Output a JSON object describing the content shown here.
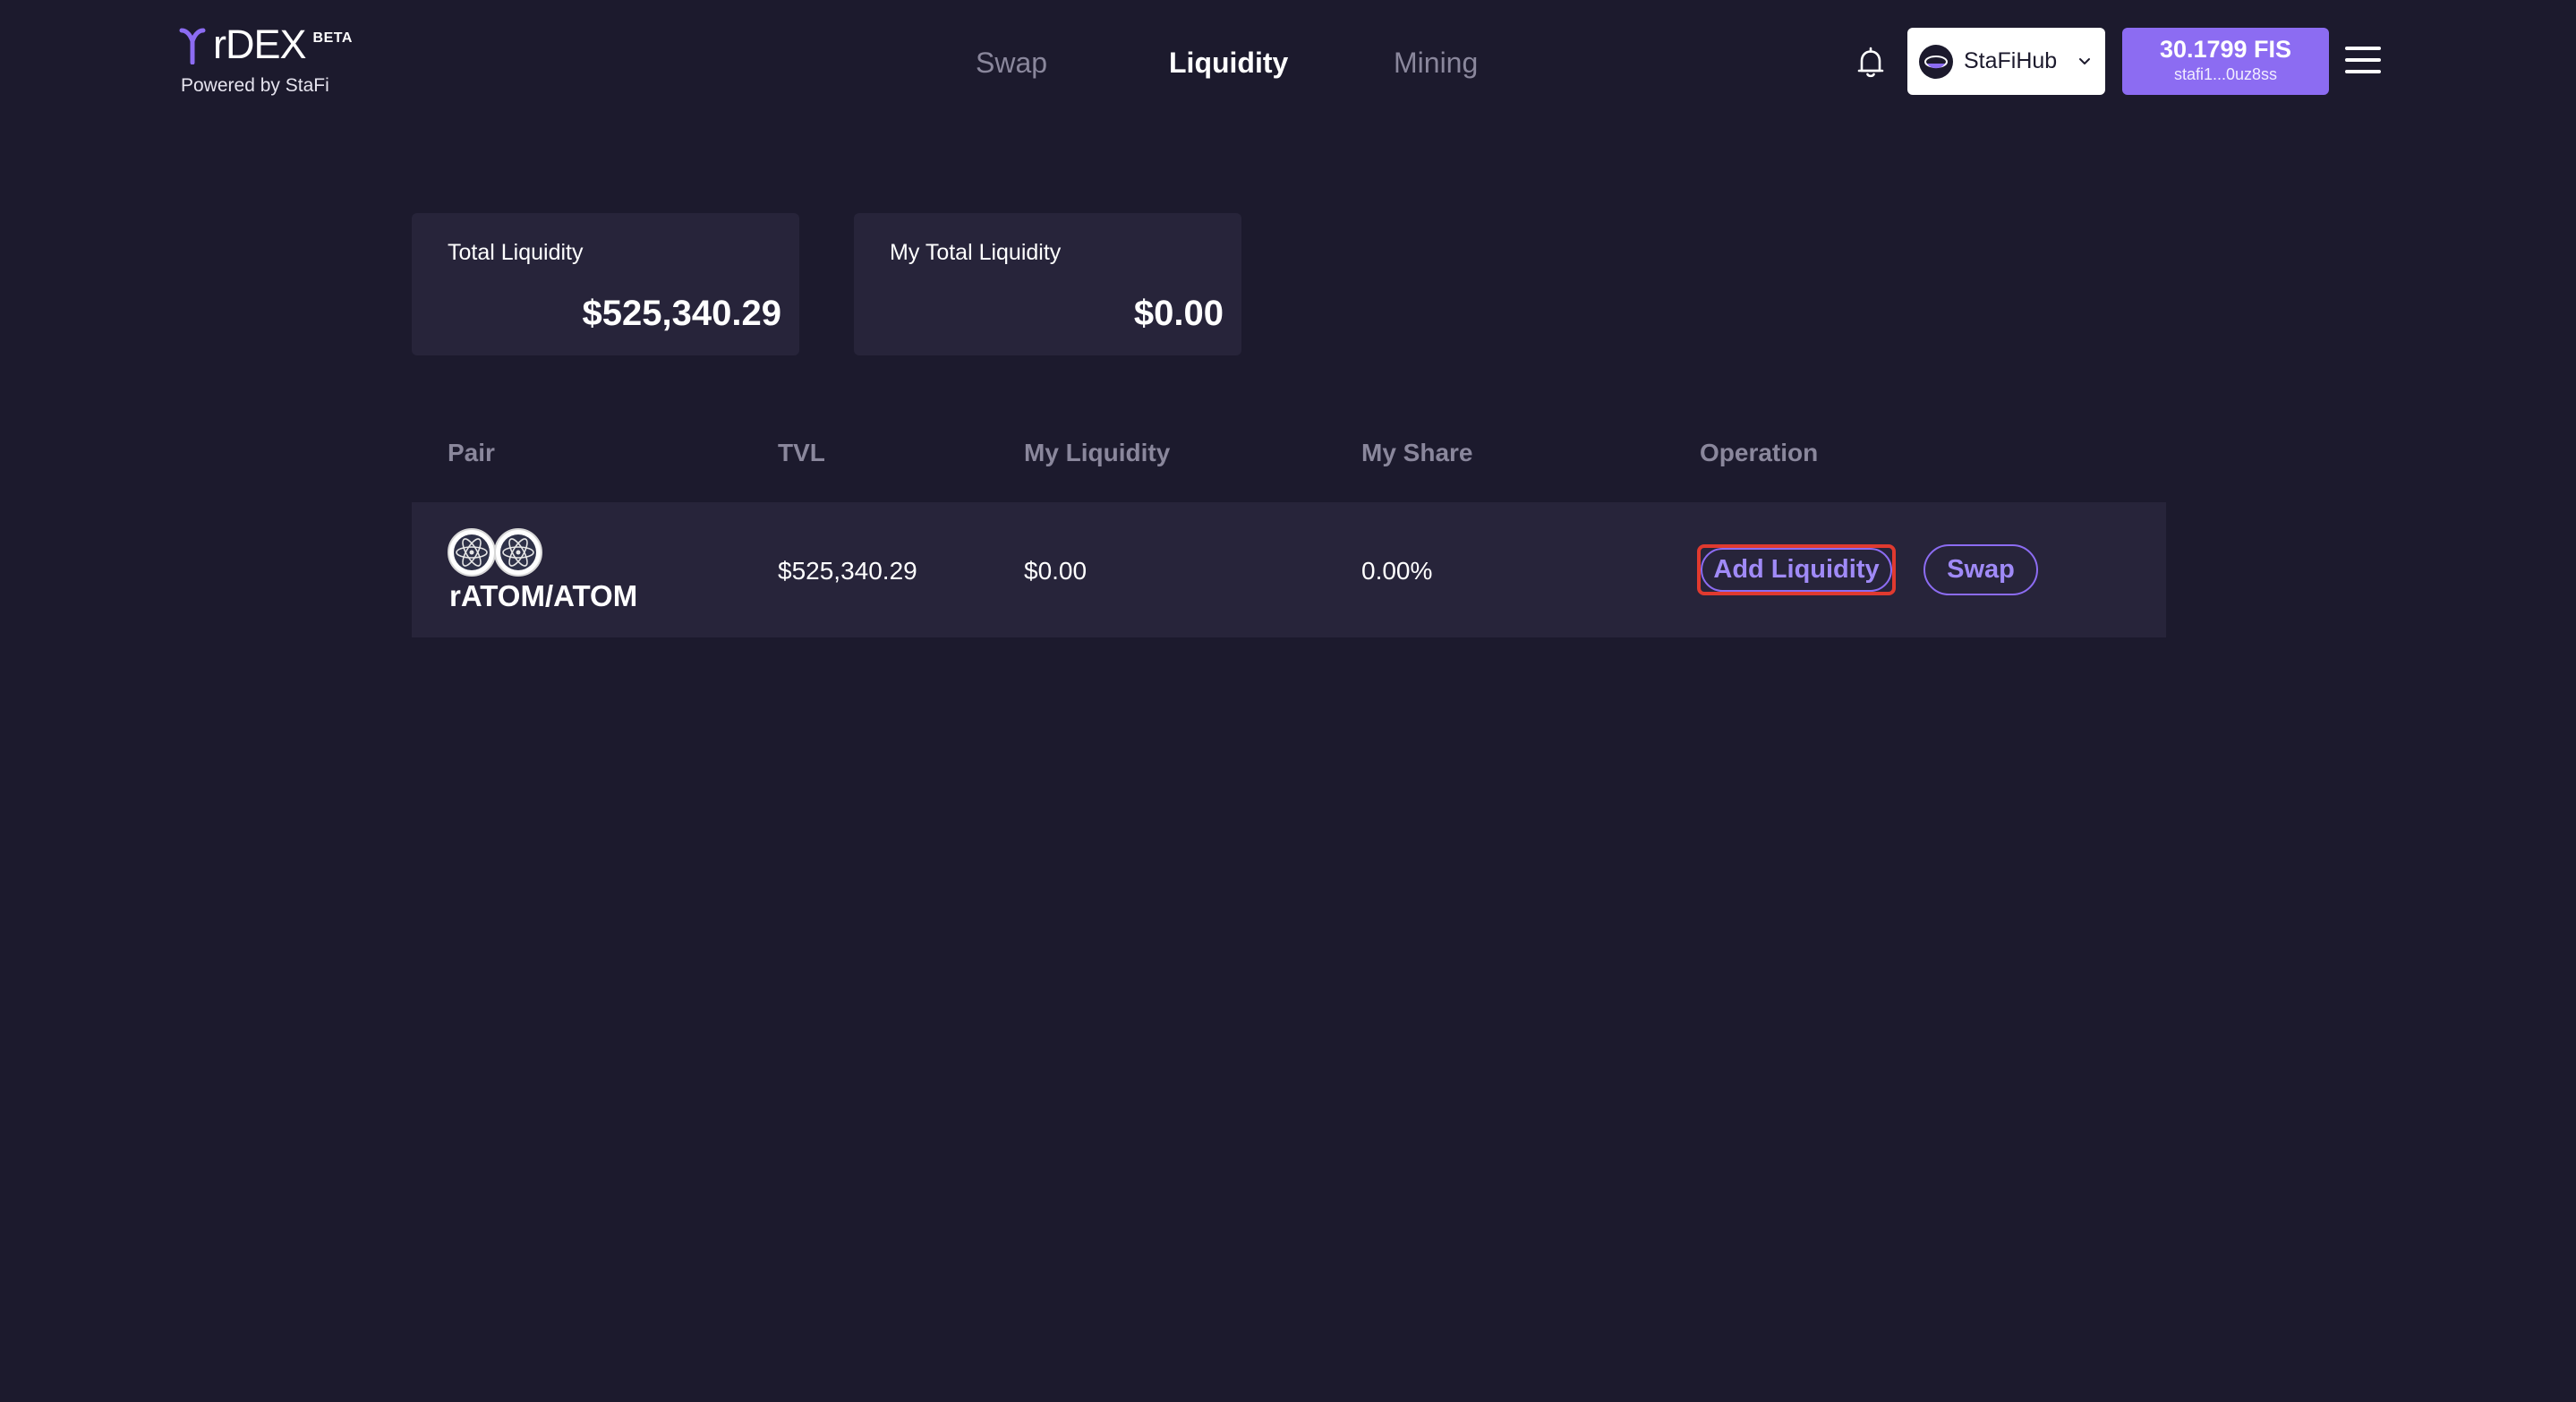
{
  "app": {
    "name": "rDEX",
    "badge": "BETA",
    "powered_by": "Powered by StaFi"
  },
  "nav": {
    "items": [
      {
        "label": "Swap",
        "active": false
      },
      {
        "label": "Liquidity",
        "active": true
      },
      {
        "label": "Mining",
        "active": false
      }
    ]
  },
  "header": {
    "bell_icon": "bell-icon",
    "network": {
      "label": "StaFiHub",
      "icon": "stafihub-logo-icon"
    },
    "wallet": {
      "balance": "30.1799 FIS",
      "address": "stafi1...0uz8ss"
    },
    "menu_icon": "hamburger-menu-icon"
  },
  "summary": {
    "total_liquidity": {
      "label": "Total Liquidity",
      "value": "$525,340.29"
    },
    "my_total_liquidity": {
      "label": "My Total Liquidity",
      "value": "$0.00"
    }
  },
  "table": {
    "columns": [
      "Pair",
      "TVL",
      "My Liquidity",
      "My Share",
      "Operation"
    ],
    "rows": [
      {
        "pair": "rATOM/ATOM",
        "tvl": "$525,340.29",
        "my_liquidity": "$0.00",
        "my_share": "0.00%",
        "actions": {
          "add": "Add Liquidity",
          "swap": "Swap"
        }
      }
    ]
  },
  "colors": {
    "background": "#1c1a2d",
    "card": "#27243a",
    "accent": "#8c6cf2",
    "highlight": "#e03a2f"
  }
}
